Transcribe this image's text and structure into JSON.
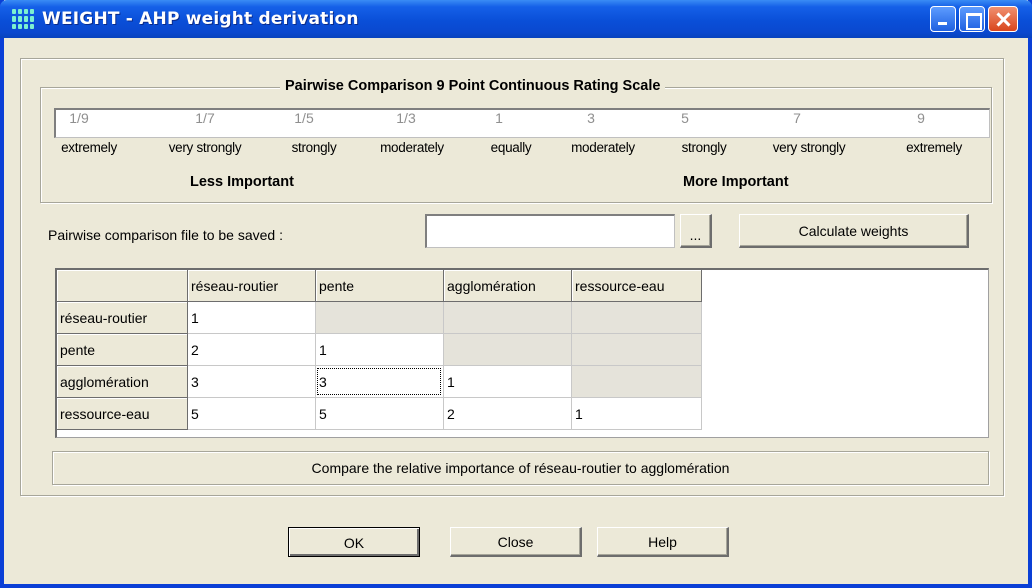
{
  "window": {
    "title": "WEIGHT - AHP weight derivation"
  },
  "scale": {
    "legend": "Pairwise Comparison 9 Point Continuous Rating Scale",
    "values": [
      "1/9",
      "1/7",
      "1/5",
      "1/3",
      "1",
      "3",
      "5",
      "7",
      "9"
    ],
    "words": [
      "extremely",
      "very strongly",
      "strongly",
      "moderately",
      "equally",
      "moderately",
      "strongly",
      "very strongly",
      "extremely"
    ],
    "less_label": "Less Important",
    "more_label": "More Important"
  },
  "file": {
    "label": "Pairwise comparison file to be saved :",
    "value": "",
    "browse_label": "..."
  },
  "calculate_label": "Calculate weights",
  "matrix": {
    "columns": [
      "réseau-routier",
      "pente",
      "agglomération",
      "ressource-eau"
    ],
    "rows": [
      {
        "label": "réseau-routier",
        "cells": [
          "1",
          "",
          "",
          ""
        ]
      },
      {
        "label": "pente",
        "cells": [
          "2",
          "1",
          "",
          ""
        ]
      },
      {
        "label": "agglomération",
        "cells": [
          "3",
          "3",
          "1",
          ""
        ]
      },
      {
        "label": "ressource-eau",
        "cells": [
          "5",
          "5",
          "2",
          "1"
        ]
      }
    ]
  },
  "status": {
    "message": "Compare the relative importance of réseau-routier to agglomération"
  },
  "buttons": {
    "ok": "OK",
    "close": "Close",
    "help": "Help"
  },
  "colors": {
    "titlebar": "#0a4fd8",
    "dialog_bg": "#ece9d8",
    "inactive_cell": "#e5e3da"
  }
}
